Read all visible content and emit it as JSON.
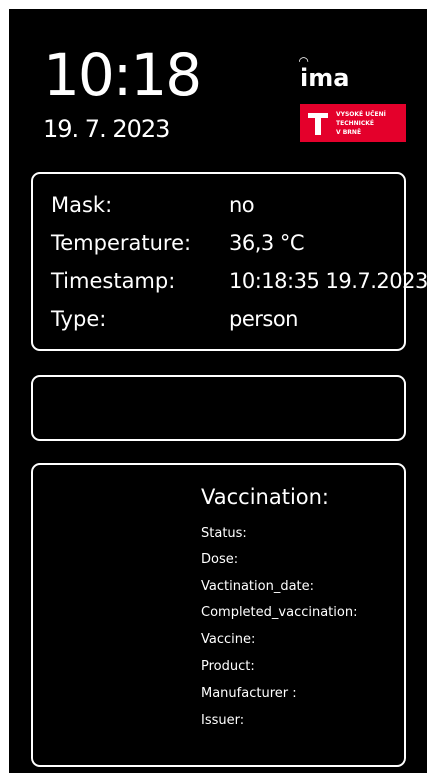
{
  "clock": {
    "time": "10:18",
    "date": "19. 7. 2023"
  },
  "logos": {
    "ima": "ima",
    "vut_lines": [
      "VYSOKÉ UČENÍ",
      "TECHNICKÉ",
      "V BRNĚ"
    ]
  },
  "detection": {
    "rows": [
      {
        "label": "Mask:",
        "value": "no"
      },
      {
        "label": "Temperature:",
        "value": "36,3 °C"
      },
      {
        "label": "Timestamp:",
        "value": "10:18:35 19.7.2023"
      },
      {
        "label": "Type:",
        "value": "person"
      }
    ]
  },
  "vaccination": {
    "title": "Vaccination:",
    "fields": [
      "Status:",
      "Dose:",
      "Vactination_date:",
      "Completed_vaccination:",
      "Vaccine:",
      "Product:",
      "Manufacturer :",
      "Issuer:"
    ]
  },
  "colors": {
    "background": "#000000",
    "foreground": "#ffffff",
    "vut_red": "#e4002b"
  }
}
